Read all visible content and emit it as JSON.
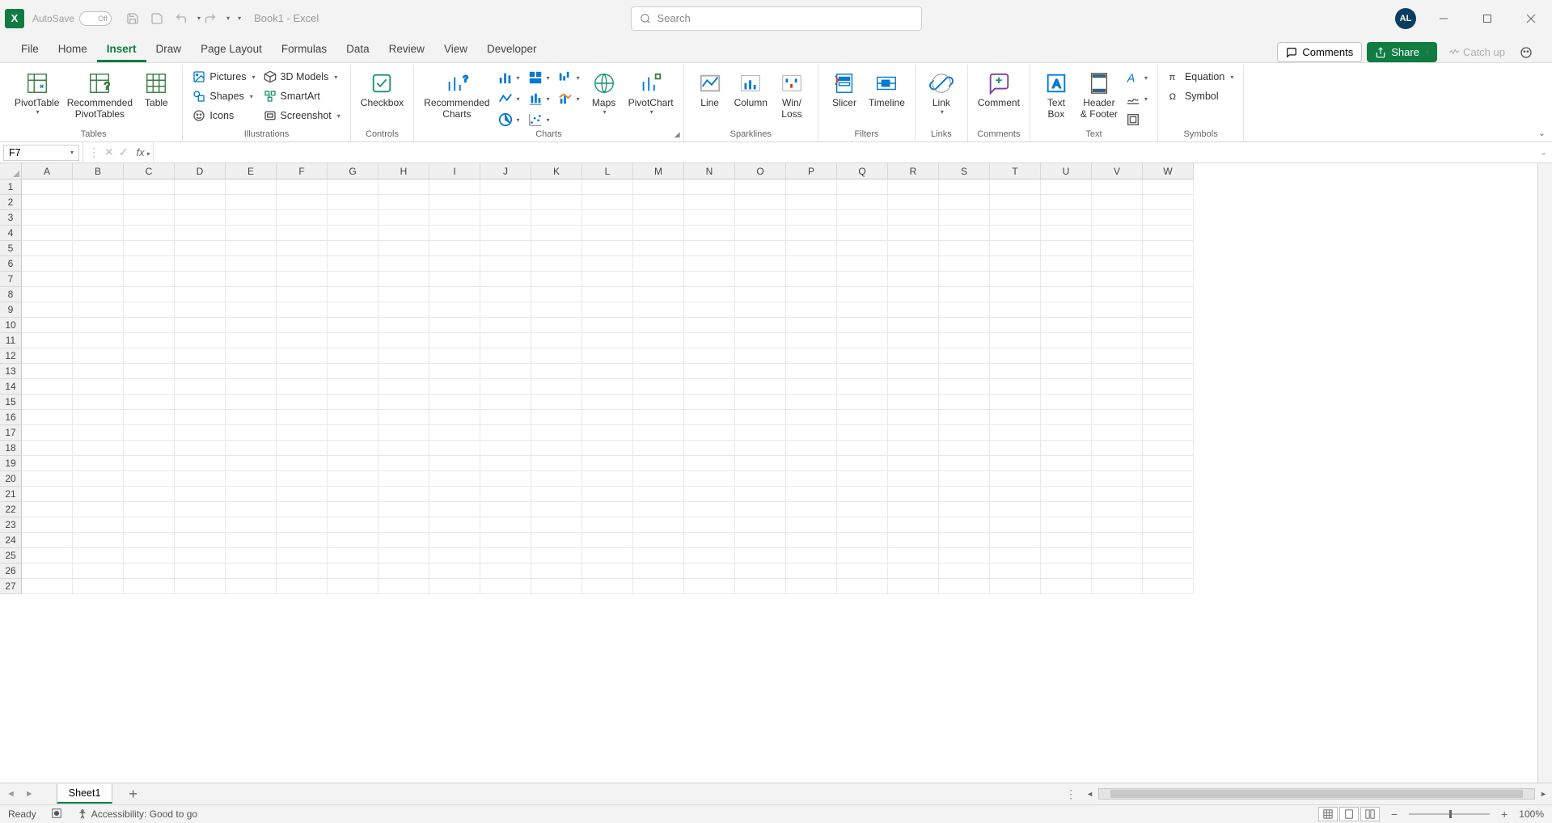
{
  "title": {
    "autosave_label": "AutoSave",
    "autosave_state": "Off",
    "document_title": "Book1 - Excel",
    "search_placeholder": "Search",
    "avatar_initials": "AL"
  },
  "tabs": {
    "items": [
      "File",
      "Home",
      "Insert",
      "Draw",
      "Page Layout",
      "Formulas",
      "Data",
      "Review",
      "View",
      "Developer"
    ],
    "active_index": 2,
    "comments": "Comments",
    "share": "Share",
    "catch_up": "Catch up"
  },
  "ribbon": {
    "groups": {
      "tables": {
        "label": "Tables",
        "pivot": "PivotTable",
        "recommended_pivot": "Recommended\nPivotTables",
        "table": "Table"
      },
      "illustrations": {
        "label": "Illustrations",
        "pictures": "Pictures",
        "shapes": "Shapes",
        "icons": "Icons",
        "models3d": "3D Models",
        "smartart": "SmartArt",
        "screenshot": "Screenshot"
      },
      "controls": {
        "label": "Controls",
        "checkbox": "Checkbox"
      },
      "rec_charts": {
        "label": "",
        "recommended_charts": "Recommended\nCharts"
      },
      "charts": {
        "label": "Charts",
        "maps": "Maps",
        "pivotchart": "PivotChart"
      },
      "sparklines": {
        "label": "Sparklines",
        "line": "Line",
        "column": "Column",
        "winloss": "Win/\nLoss"
      },
      "filters": {
        "label": "Filters",
        "slicer": "Slicer",
        "timeline": "Timeline"
      },
      "links": {
        "label": "Links",
        "link": "Link"
      },
      "comments": {
        "label": "Comments",
        "comment": "Comment"
      },
      "text": {
        "label": "Text",
        "textbox": "Text\nBox",
        "headerfooter": "Header\n& Footer"
      },
      "symbols": {
        "label": "Symbols",
        "equation": "Equation",
        "symbol": "Symbol"
      }
    }
  },
  "formula_bar": {
    "name_box": "F7",
    "formula": ""
  },
  "grid": {
    "columns": [
      "A",
      "B",
      "C",
      "D",
      "E",
      "F",
      "G",
      "H",
      "I",
      "J",
      "K",
      "L",
      "M",
      "N",
      "O",
      "P",
      "Q",
      "R",
      "S",
      "T",
      "U",
      "V",
      "W"
    ],
    "row_count": 27
  },
  "sheet_tabs": {
    "active": "Sheet1"
  },
  "status": {
    "ready": "Ready",
    "accessibility": "Accessibility: Good to go",
    "zoom": "100%"
  }
}
